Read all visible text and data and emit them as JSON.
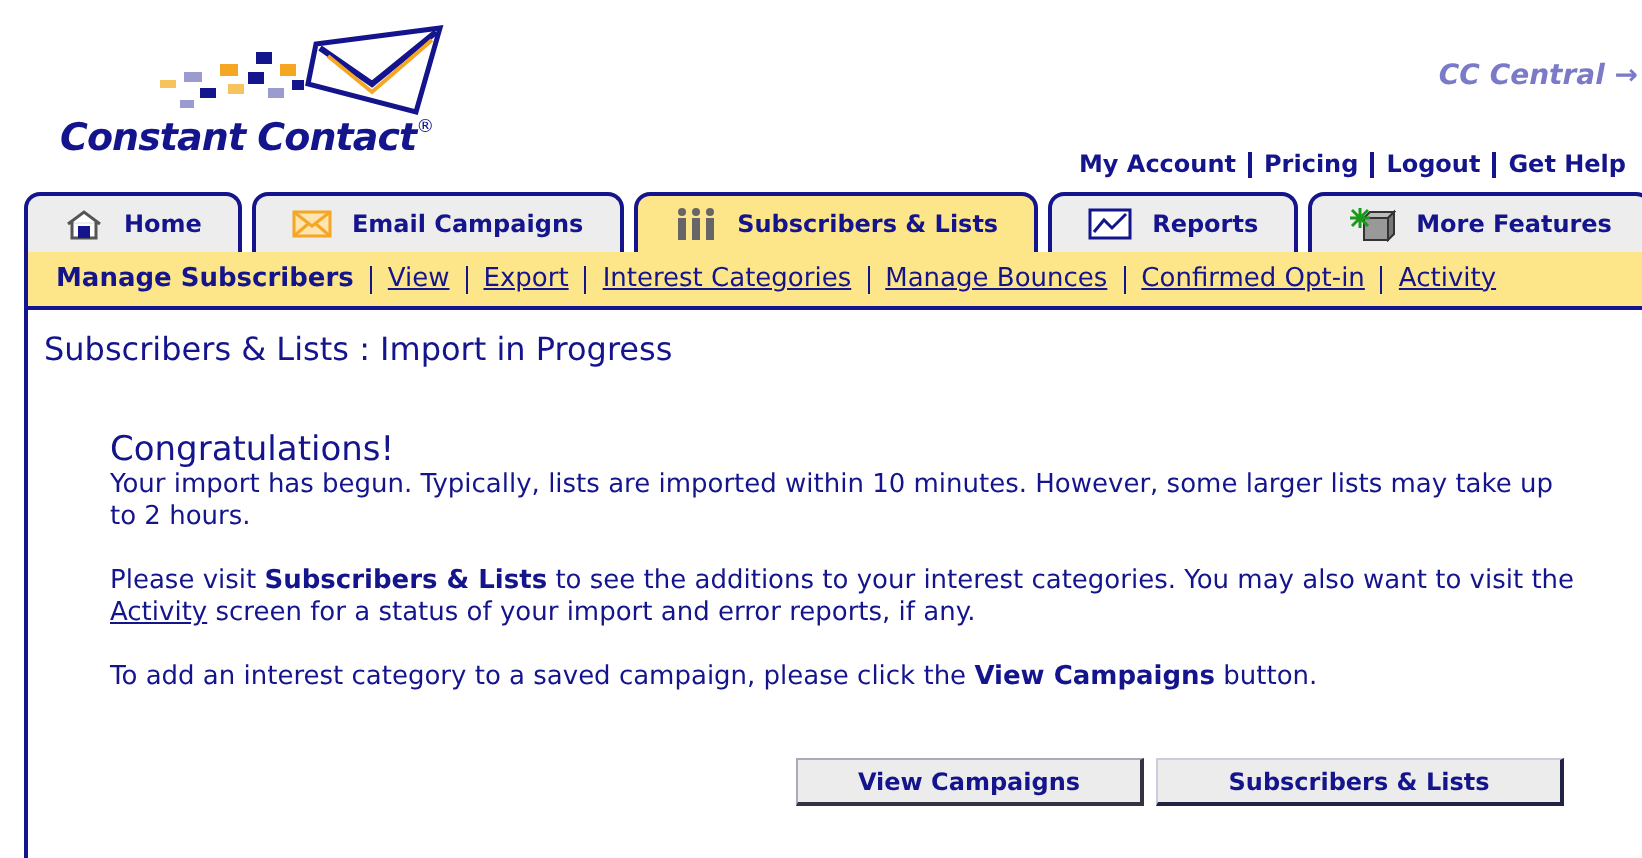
{
  "logo": {
    "name": "Constant Contact",
    "mark": "®"
  },
  "cc_central": "CC Central →",
  "top_links": [
    "My Account",
    "Pricing",
    "Logout",
    "Get Help"
  ],
  "tabs": [
    {
      "label": "Home",
      "selected": false
    },
    {
      "label": "Email Campaigns",
      "selected": false
    },
    {
      "label": "Subscribers & Lists",
      "selected": true
    },
    {
      "label": "Reports",
      "selected": false
    },
    {
      "label": "More Features",
      "selected": false
    }
  ],
  "subnav": {
    "title": "Manage Subscribers",
    "links": [
      "View",
      "Export",
      "Interest Categories",
      "Manage Bounces",
      "Confirmed Opt-in",
      "Activity"
    ]
  },
  "page_title": "Subscribers & Lists : Import in Progress",
  "heading": "Congratulations!",
  "paragraphs": [
    {
      "before": "Your import has begun. Typically, lists are imported within 10 minutes. However, some larger lists may take up to 2 hours."
    },
    {
      "before": "Please visit **Subscribers & Lists** to see the additions to your interest categories. You may also want to visit the ",
      "link": "Activity",
      "after": " screen for a status of your import and error reports, if any."
    },
    {
      "before": "To add an interest category to a saved campaign, please click the **View Campaigns** button."
    }
  ],
  "buttons": [
    {
      "label": "View Campaigns",
      "kind": "light"
    },
    {
      "label": "Subscribers & Lists",
      "kind": "dark"
    }
  ]
}
